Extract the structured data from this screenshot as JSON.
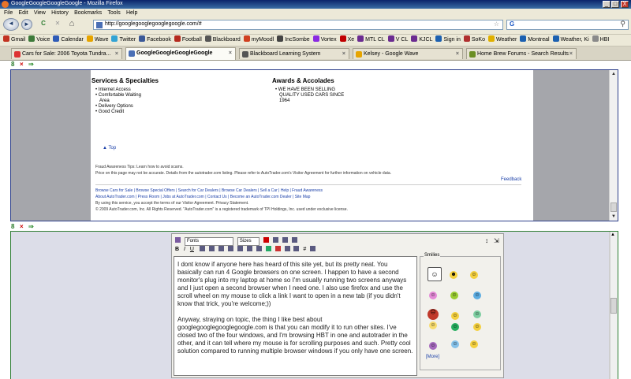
{
  "window": {
    "title": "GoogleGoogleGoogleGoogle - Mozilla Firefox",
    "minimize": "_",
    "maximize": "□",
    "close": "X"
  },
  "menu": [
    "File",
    "Edit",
    "View",
    "History",
    "Bookmarks",
    "Tools",
    "Help"
  ],
  "nav": {
    "back": "◄",
    "forward": "►",
    "reload": "C",
    "stop": "✕",
    "home": "⌂",
    "url": "http://googlegooglegooglegoogle.com/#",
    "search_placeholder": "G"
  },
  "bookmarks": [
    {
      "label": "Gmail",
      "color": "#c23321"
    },
    {
      "label": "Voice",
      "color": "#3d7a3a"
    },
    {
      "label": "Calendar",
      "color": "#2f5bb7"
    },
    {
      "label": "Wave",
      "color": "#e6a400"
    },
    {
      "label": "Twitter",
      "color": "#33a3d4"
    },
    {
      "label": "Facebook",
      "color": "#3b5998"
    },
    {
      "label": "Football",
      "color": "#b52a1f"
    },
    {
      "label": "Blackboard",
      "color": "#555555"
    },
    {
      "label": "myMoodl",
      "color": "#d04020"
    },
    {
      "label": "IncSombe",
      "color": "#444444"
    },
    {
      "label": "Vortex",
      "color": "#8a2be2"
    },
    {
      "label": "Xe",
      "color": "#c00000"
    },
    {
      "label": "MTL CL",
      "color": "#6b2c91"
    },
    {
      "label": "V CL",
      "color": "#6b2c91"
    },
    {
      "label": "KJCL",
      "color": "#6b2c91"
    },
    {
      "label": "Sign in",
      "color": "#1c60b0"
    },
    {
      "label": "SoKo",
      "color": "#b03030"
    },
    {
      "label": "Weather",
      "color": "#e0b000"
    },
    {
      "label": "Montreal",
      "color": "#1c60b0"
    },
    {
      "label": "Weather, Ki",
      "color": "#1c60b0"
    },
    {
      "label": "HBI",
      "color": "#8a8a8a"
    }
  ],
  "tabs": [
    {
      "label": "Cars for Sale: 2006 Toyota Tundra...",
      "active": false,
      "color": "#d33"
    },
    {
      "label": "GoogleGoogleGoogleGoogle",
      "active": true,
      "color": "#4a6fb5"
    },
    {
      "label": "Blackboard Learning System",
      "active": false,
      "color": "#555"
    },
    {
      "label": "Kelsey - Google Wave",
      "active": false,
      "color": "#e6a400"
    },
    {
      "label": "Home Brew Forums - Search Results",
      "active": false,
      "color": "#6b8e23"
    }
  ],
  "pane_tools": {
    "logo": "8",
    "close": "×",
    "go": "⇒"
  },
  "pane1": {
    "services_heading": "Services & Specialties",
    "services": [
      "Internet Access",
      "Comfortable Waiting",
      "Area",
      "Delivery Options",
      "Good Credit"
    ],
    "awards_heading": "Awards & Accolades",
    "awards": [
      "WE HAVE BEEN SELLING",
      "QUALITY USED CARS SINCE",
      "1964"
    ],
    "top_link": "▲ Top",
    "fraud_line": "Fraud Awareness Tips: Learn how to avoid scams.",
    "disclaimer": "Price on this page may not be accurate. Details from the autotrader.com listing. Please refer to AutoTrader.com's Visitor Agreement for further information on vehicle data.",
    "feedback": "Feedback",
    "footer_links": "Browse Cars for Sale | Browse Special Offers | Search for Car Dealers | Browse Car Dealers | Sell a Car | Help | Fraud Awareness",
    "footer_links2": "About AutoTrader.com | Press Room | Jobs at AutoTrader.com | Contact Us | Become an AutoTrader.com Dealer | Site Map",
    "agreement": "By using this service, you accept the terms of our Visitor Agreement. Privacy Statement.",
    "copyright": "© 2009 AutoTrader.com, Inc. All Rights Reserved. \"AutoTrader.com\" is a registered trademark of TPI Holdings, Inc. used under exclusive license."
  },
  "editor": {
    "font_select": "Fonts",
    "size_select": "Sizes",
    "smilies_label": "Smilies",
    "more_label": "[More]",
    "paragraph1": "I dont know if anyone here has heard of this site yet, but its pretty neat. You basically can run 4 Google browsers on one screen. I happen to have a second monitor's plug into my laptop at home so I'm usually running two screens anyways and I just open a second browser when I need one. I also use firefox and use the scroll wheel on my mouse to click a link I want to open in a new tab (if you didn't know that trick, you're welcome;))",
    "paragraph2": "Anyway, straying on topic, the thing I like best about googlegooglegooglegoogle.com is that you can modify it to run other sites. I've closed two of the four windows, and I'm browsing HBT in one and autotrader in the other, and it can tell where my mouse is for scrolling purposes and such. Pretty cool solution compared to running multiple browser windows if you only have one screen."
  }
}
